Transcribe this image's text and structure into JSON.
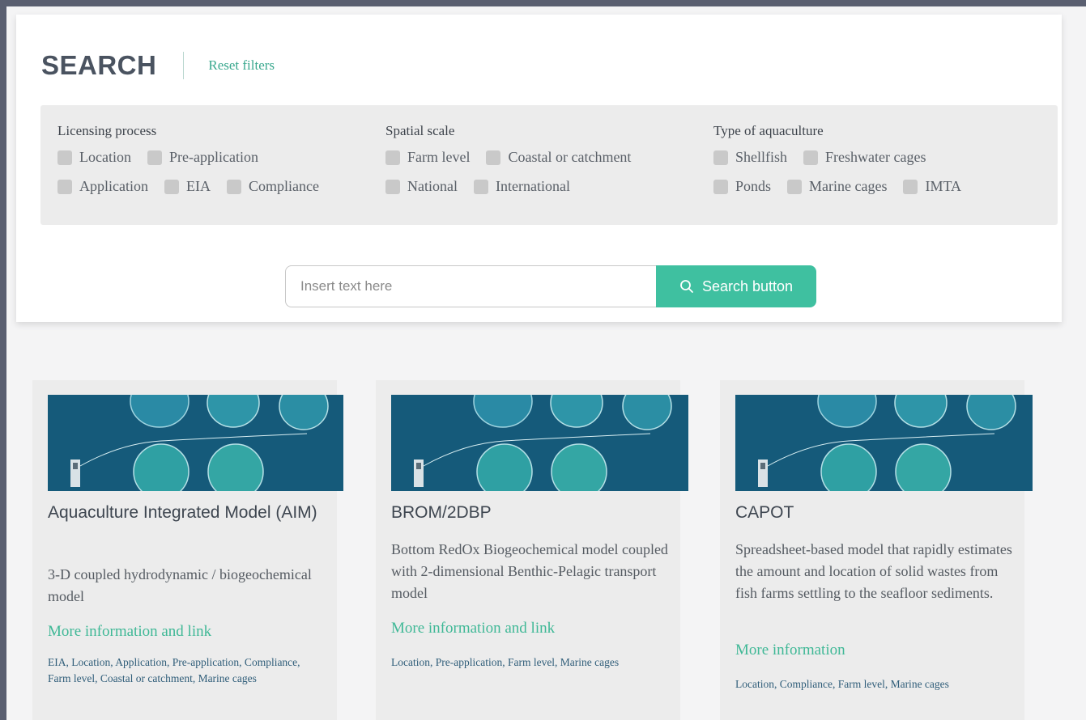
{
  "search": {
    "title": "SEARCH",
    "reset_label": "Reset filters",
    "input_placeholder": "Insert text here",
    "button_label": "Search button"
  },
  "filters": {
    "licensing": {
      "heading": "Licensing process",
      "row1": [
        "Location",
        "Pre-application"
      ],
      "row2": [
        "Application",
        "EIA",
        "Compliance"
      ]
    },
    "spatial": {
      "heading": "Spatial scale",
      "row1": [
        "Farm level",
        "Coastal or catchment"
      ],
      "row2": [
        "National",
        "International"
      ]
    },
    "aquaculture": {
      "heading": "Type of aquaculture",
      "row1": [
        "Shellfish",
        "Freshwater cages"
      ],
      "row2": [
        "Ponds",
        "Marine cages",
        "IMTA"
      ]
    }
  },
  "cards": [
    {
      "title": "Aquaculture Integrated Model (AIM)",
      "description": "3-D coupled hydrodynamic / biogeochemical model",
      "link": "More information and link",
      "tags": "EIA, Location, Application, Pre-application, Compliance, Farm level, Coastal or catchment, Marine cages"
    },
    {
      "title": "BROM/2DBP",
      "description": "Bottom RedOx Biogeochemical model coupled with 2-dimensional Benthic-Pelagic transport model",
      "link": "More information and link",
      "tags": "Location, Pre-application, Farm level, Marine cages"
    },
    {
      "title": "CAPOT",
      "description": "Spreadsheet-based model that rapidly estimates the amount and location of solid wastes from fish farms settling to the seafloor sediments.",
      "link": "More information",
      "tags": "Location, Compliance, Farm level, Marine cages"
    }
  ],
  "colors": {
    "accent": "#3fc0a0",
    "tag_text": "#2f5d79",
    "image_sea": "#155a7a"
  }
}
